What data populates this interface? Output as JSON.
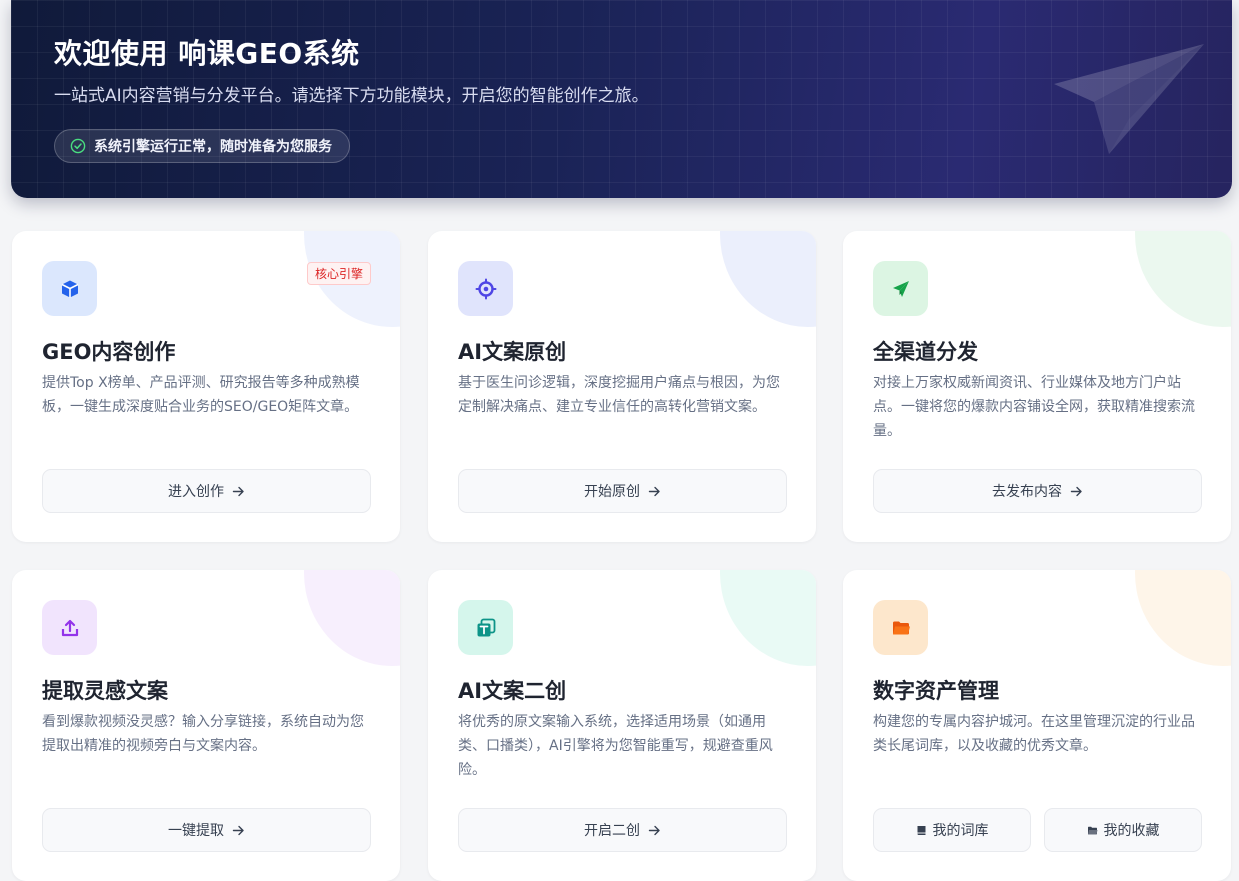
{
  "hero": {
    "title": "欢迎使用 响课GEO系统",
    "subtitle": "一站式AI内容营销与分发平台。请选择下方功能模块，开启您的智能创作之旅。",
    "status": "系统引擎运行正常，随时准备为您服务",
    "status_icon": "check-circle-icon",
    "bg_icon": "paper-plane-icon"
  },
  "cards": [
    {
      "title": "GEO内容创作",
      "tag": "核心引擎",
      "desc": "提供Top X榜单、产品评测、研究报告等多种成熟模板，一键生成深度贴合业务的SEO/GEO矩阵文章。",
      "button": "进入创作",
      "icon": "cube-icon",
      "accent": "#2563eb"
    },
    {
      "title": "AI文案原创",
      "desc": "基于医生问诊逻辑，深度挖掘用户痛点与根因，为您定制解决痛点、建立专业信任的高转化营销文案。",
      "button": "开始原创",
      "icon": "target-icon",
      "accent": "#4f46e5"
    },
    {
      "title": "全渠道分发",
      "desc": "对接上万家权威新闻资讯、行业媒体及地方门户站点。一键将您的爆款内容铺设全网，获取精准搜索流量。",
      "button": "去发布内容",
      "icon": "send-icon",
      "accent": "#16a34a"
    },
    {
      "title": "提取灵感文案",
      "desc": "看到爆款视频没灵感？输入分享链接，系统自动为您提取出精准的视频旁白与文案内容。",
      "button": "一键提取",
      "icon": "upload-icon",
      "accent": "#9333ea"
    },
    {
      "title": "AI文案二创",
      "desc": "将优秀的原文案输入系统，选择适用场景（如通用类、口播类），AI引擎将为您智能重写，规避查重风险。",
      "button": "开启二创",
      "icon": "text-copy-icon",
      "accent": "#0d9488"
    },
    {
      "title": "数字资产管理",
      "desc": "构建您的专属内容护城河。在这里管理沉淀的行业品类长尾词库，以及收藏的优秀文章。",
      "button_left": "我的词库",
      "button_right": "我的收藏",
      "icon": "folder-icon",
      "accent": "#ea580c"
    }
  ]
}
